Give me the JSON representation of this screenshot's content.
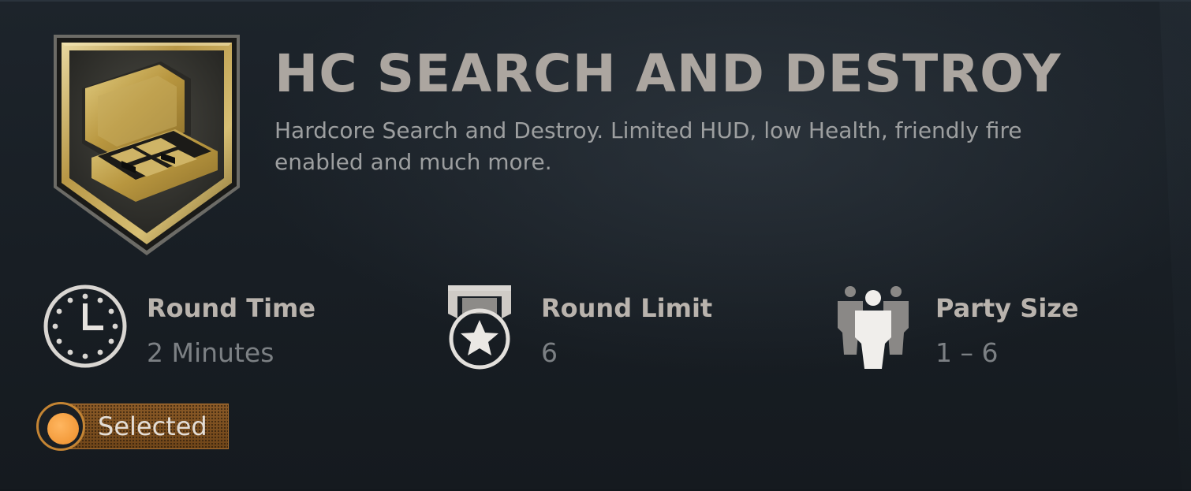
{
  "mode": {
    "title": "HC SEARCH AND DESTROY",
    "description": "Hardcore Search and Destroy. Limited HUD, low Health, friendly fire enabled and much more.",
    "emblem_icon": "briefcase-bomb-emblem-icon"
  },
  "stats": {
    "round_time": {
      "label": "Round Time",
      "value": "2 Minutes",
      "icon": "clock-icon"
    },
    "round_limit": {
      "label": "Round Limit",
      "value": "6",
      "icon": "star-medal-icon"
    },
    "party_size": {
      "label": "Party Size",
      "value": "1 – 6",
      "icon": "party-people-icon"
    }
  },
  "selection": {
    "label": "Selected",
    "icon": "radio-selected-icon",
    "accent_color": "#f39a3a"
  },
  "colors": {
    "title": "#aca6a0",
    "description": "#9d9fa0",
    "stat_label": "#b9b3ad",
    "stat_value": "#7c8084",
    "emblem_gold": "#c9a955"
  }
}
